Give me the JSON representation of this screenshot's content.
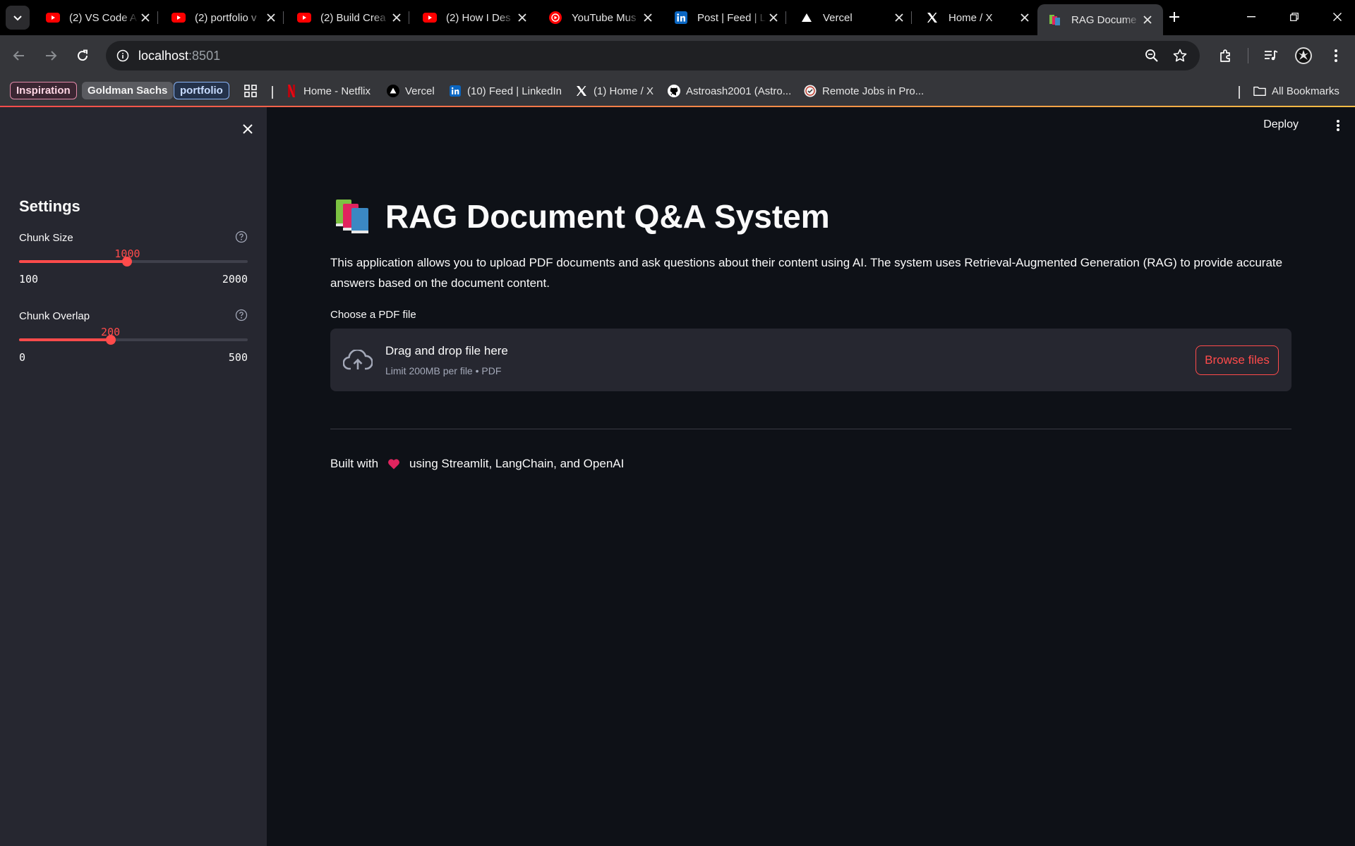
{
  "browser": {
    "tabs": [
      {
        "title": "(2) VS Code A",
        "favicon": "youtube-icon",
        "active": false
      },
      {
        "title": "(2) portfolio v",
        "favicon": "youtube-icon",
        "active": false
      },
      {
        "title": "(2) Build Crea",
        "favicon": "youtube-icon",
        "active": false
      },
      {
        "title": "(2) How I Des",
        "favicon": "youtube-icon",
        "active": false
      },
      {
        "title": "YouTube Mus",
        "favicon": "youtube-music-icon",
        "active": false
      },
      {
        "title": "Post | Feed | L",
        "favicon": "linkedin-icon",
        "active": false
      },
      {
        "title": "Vercel",
        "favicon": "vercel-icon",
        "active": false
      },
      {
        "title": "Home / X",
        "favicon": "x-icon",
        "active": false
      },
      {
        "title": "RAG Docume",
        "favicon": "books-icon",
        "active": true
      }
    ],
    "address": {
      "host": "localhost",
      "port": ":8501"
    },
    "bookmarks": {
      "pills": [
        "Inspiration",
        "Goldman Sachs",
        "portfolio"
      ],
      "links": [
        "Home - Netflix",
        "Vercel",
        "(10) Feed | LinkedIn",
        "(1) Home / X",
        "Astroash2001 (Astro...",
        "Remote Jobs in Pro..."
      ],
      "all_label": "All Bookmarks"
    },
    "colors": {
      "accent_gradient_start": "#ff4b4b",
      "accent_gradient_end": "#ffbd45"
    }
  },
  "app": {
    "header": {
      "deploy_label": "Deploy"
    },
    "sidebar": {
      "heading": "Settings",
      "sliders": [
        {
          "label": "Chunk Size",
          "value": "1000",
          "min": "100",
          "max": "2000",
          "fraction": 0.4737
        },
        {
          "label": "Chunk Overlap",
          "value": "200",
          "min": "0",
          "max": "500",
          "fraction": 0.4
        }
      ]
    },
    "main": {
      "title": "RAG Document Q&A System",
      "title_icon": "books-icon",
      "intro": "This application allows you to upload PDF documents and ask questions about their content using AI. The system uses Retrieval-Augmented Generation (RAG) to provide accurate answers based on the document content.",
      "uploader": {
        "label": "Choose a PDF file",
        "drop_title": "Drag and drop file here",
        "limit": "Limit 200MB per file • PDF",
        "button": "Browse files"
      },
      "footer": {
        "before": "Built with",
        "after": "using Streamlit, LangChain, and OpenAI"
      }
    },
    "colors": {
      "primary": "#ff4b4b",
      "background": "#0e1117",
      "sidebar": "#262730"
    }
  }
}
